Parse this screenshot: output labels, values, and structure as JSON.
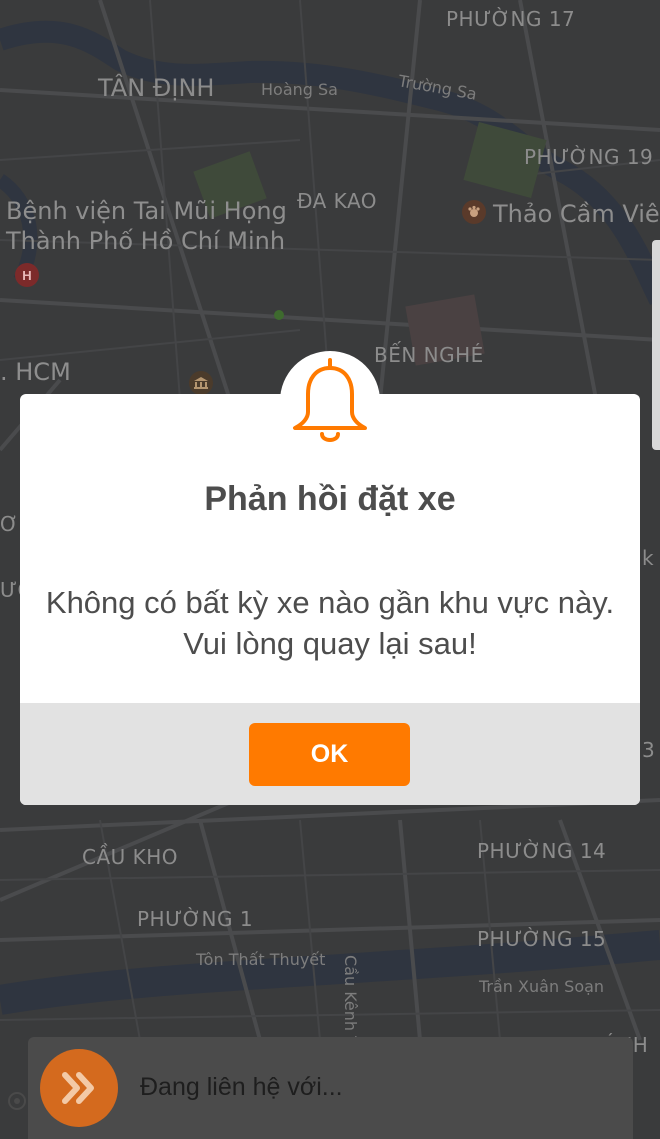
{
  "map": {
    "labels": {
      "phuong17": "PHƯỜNG 17",
      "tanDinh": "TÂN ĐỊNH",
      "hoangSa": "Hoàng Sa",
      "truongSa": "Trường Sa",
      "phuong19": "PHƯỜNG 19",
      "daKao": "ĐA KAO",
      "hospitalLine1": "Bệnh viện Tai Mũi Họng",
      "hospitalLine2": "Thành Phố Hồ Chí Minh",
      "thaoCamVien": "Thảo Cầm Viên",
      "benNghe": "BẾN NGHÉ",
      "hcm": ". HCM",
      "cauKho": "CẦU KHO",
      "phuong14": "PHƯỜNG 14",
      "phuong1": "PHƯỜNG 1",
      "phuong15": "PHƯỜNG 15",
      "tonThatThuyet": "Tôn Thất Thuyết",
      "tranXuanSoan": "Trần Xuân Soạn",
      "cauKenhTe": "Cầu Kênh Tẻ",
      "edgeRight": "k",
      "edgeRight2": "3",
      "edgeLeft1": "ƠN",
      "edgeLeft2": "ƯỚ",
      "khanh": "KHÁNH"
    },
    "icons": {
      "hospital": "H"
    }
  },
  "dialog": {
    "icon": "bell-icon",
    "title": "Phản hồi đặt xe",
    "message": "Không có bất kỳ xe nào gần khu vực này. Vui lòng quay lại sau!",
    "ok_label": "OK"
  },
  "status_card": {
    "icon": "double-chevron-right-icon",
    "text": "Đang liên hệ với..."
  },
  "colors": {
    "accent": "#ff7a00",
    "map_background": "#3a3b3c",
    "dialog_footer": "#e2e2e2"
  }
}
